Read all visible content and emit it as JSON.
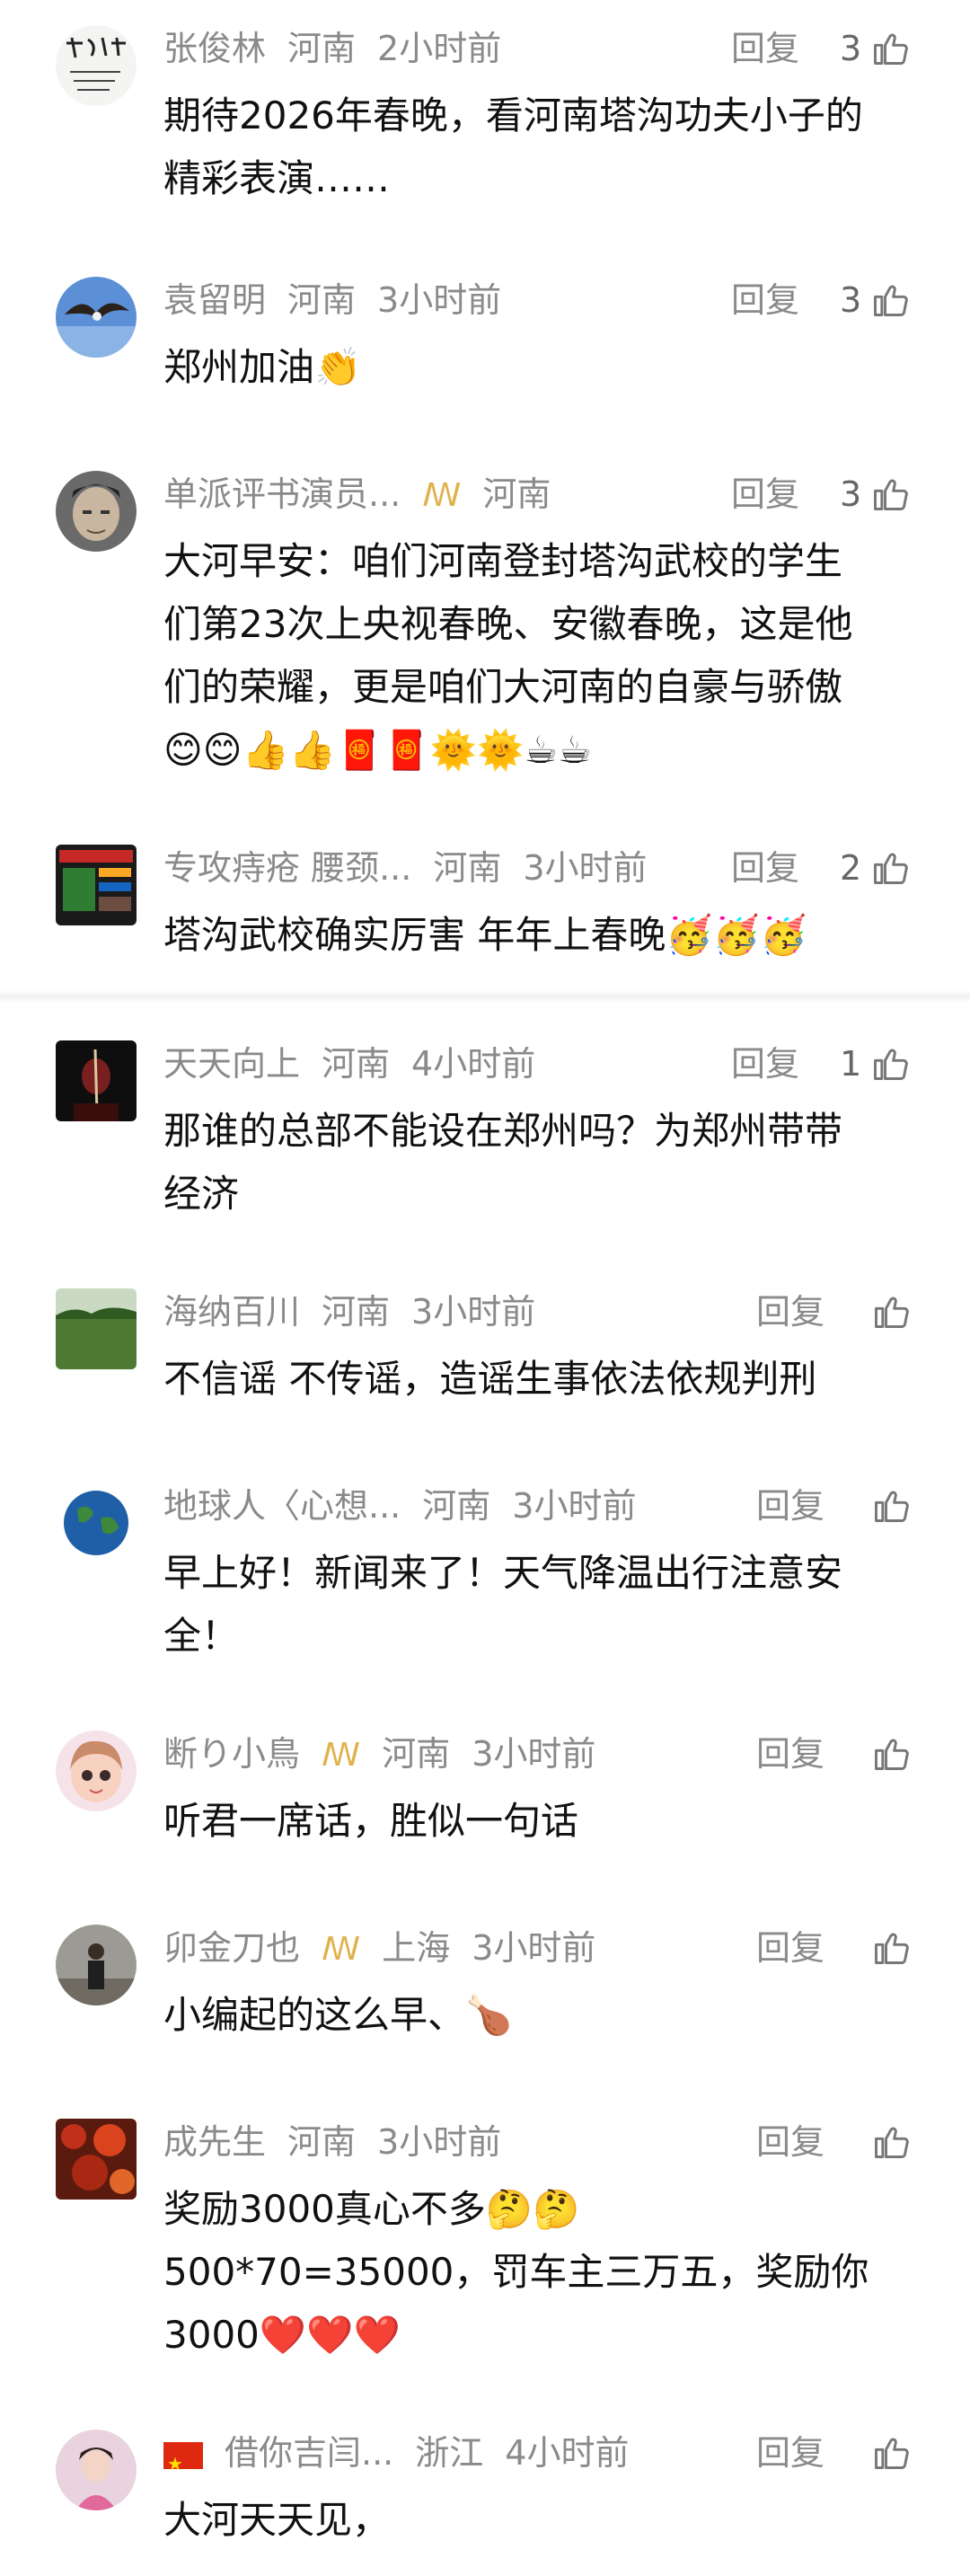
{
  "comments": [
    {
      "user": "张俊林",
      "location": "河南",
      "time": "2小时前",
      "reply": "回复",
      "likes": "3",
      "lines": [
        "期待2026年春晚，看河南塔沟功夫小子的",
        "精彩表演……"
      ]
    },
    {
      "user": "袁留明",
      "location": "河南",
      "time": "3小时前",
      "reply": "回复",
      "likes": "3",
      "lines": [
        "郑州加油👏"
      ]
    },
    {
      "user": "单派评书演员...",
      "badge": "ꟿ",
      "location": "河南",
      "time": "",
      "reply": "回复",
      "likes": "3",
      "lines": [
        "大河早安：咱们河南登封塔沟武校的学生",
        "们第23次上央视春晚、安徽春晚，这是他",
        "们的荣耀，更是咱们大河南的自豪与骄傲",
        "😊😊👍👍🧧🧧🌞🌞☕☕"
      ]
    },
    {
      "user": "专攻痔疮 腰颈...",
      "location": "河南",
      "time": "3小时前",
      "reply": "回复",
      "likes": "2",
      "lines": [
        "塔沟武校确实厉害 年年上春晚🥳🥳🥳"
      ]
    },
    {
      "user": "天天向上",
      "location": "河南",
      "time": "4小时前",
      "reply": "回复",
      "likes": "1",
      "lines": [
        "那谁的总部不能设在郑州吗？为郑州带带",
        "经济"
      ]
    },
    {
      "user": "海纳百川",
      "location": "河南",
      "time": "3小时前",
      "reply": "回复",
      "likes": "",
      "lines": [
        "不信谣 不传谣，造谣生事依法依规判刑"
      ]
    },
    {
      "user": "地球人〈心想...",
      "location": "河南",
      "time": "3小时前",
      "reply": "回复",
      "likes": "",
      "lines": [
        "早上好！新闻来了！天气降温出行注意安",
        "全！"
      ]
    },
    {
      "user": "断り小鳥",
      "badge": "ꟿ",
      "location": "河南",
      "time": "3小时前",
      "reply": "回复",
      "likes": "",
      "lines": [
        "听君一席话，胜似一句话"
      ]
    },
    {
      "user": "卯金刀也",
      "badge": "ꟿ",
      "location": "上海",
      "time": "3小时前",
      "reply": "回复",
      "likes": "",
      "lines": [
        "小编起的这么早、🍗"
      ]
    },
    {
      "user": "成先生",
      "location": "河南",
      "time": "3小时前",
      "reply": "回复",
      "likes": "",
      "lines": [
        "奖励3000真心不多🤔🤔",
        "500*70=35000，罚车主三万五，奖励你",
        "3000❤️❤️❤️"
      ]
    },
    {
      "user": "借你吉闫...",
      "flag": true,
      "location": "浙江",
      "time": "4小时前",
      "reply": "回复",
      "likes": "",
      "lines": [
        "大河天天见，"
      ]
    }
  ],
  "avatar_icons": [
    "calligraphy-avatar",
    "eagle-avatar",
    "old-man-avatar",
    "ad-banner-avatar",
    "dark-portrait-avatar",
    "green-field-avatar",
    "earth-avatar",
    "cartoon-girl-avatar",
    "man-standing-avatar",
    "red-leaves-avatar",
    "girl-pink-avatar"
  ],
  "colors": {
    "meta_text": "#8a8a8a",
    "body_text": "#111111",
    "badge": "#e0b24e"
  }
}
